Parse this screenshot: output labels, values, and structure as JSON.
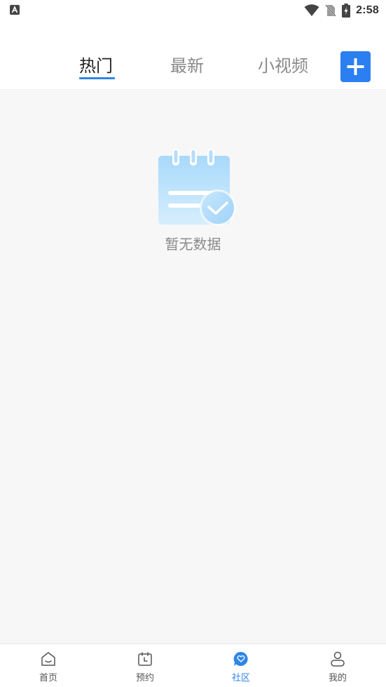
{
  "status_bar": {
    "time": "2:58",
    "icons": [
      "a-notification-icon",
      "wifi-icon",
      "no-sim-icon",
      "battery-charging-icon"
    ]
  },
  "header": {
    "tabs": [
      {
        "label": "热门",
        "active": true
      },
      {
        "label": "最新",
        "active": false
      },
      {
        "label": "小视频",
        "active": false
      }
    ],
    "add_button_icon": "plus-icon",
    "accent_color": "#2b7ff0"
  },
  "content": {
    "empty_icon": "empty-notebook-icon",
    "empty_text": "暂无数据"
  },
  "bottom_nav": {
    "items": [
      {
        "label": "首页",
        "icon": "home-icon",
        "active": false
      },
      {
        "label": "预约",
        "icon": "calendar-icon",
        "active": false
      },
      {
        "label": "社区",
        "icon": "community-chat-icon",
        "active": true
      },
      {
        "label": "我的",
        "icon": "person-icon",
        "active": false
      }
    ],
    "active_color": "#2e86e8"
  }
}
